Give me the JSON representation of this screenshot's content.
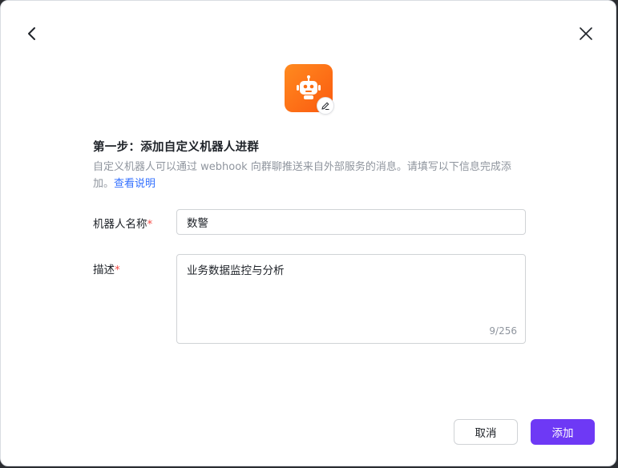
{
  "dialog": {
    "back_icon": "chevron-left-icon",
    "close_icon": "close-icon",
    "avatar_icon": "robot-icon",
    "edit_icon": "pencil-icon",
    "accent_color": "#6e39f5",
    "avatar_color": "#fb6f14"
  },
  "step": {
    "title": "第一步：添加自定义机器人进群",
    "description": "自定义机器人可以通过 webhook 向群聊推送来自外部服务的消息。请填写以下信息完成添加。",
    "help_link": "查看说明"
  },
  "form": {
    "name_label": "机器人名称",
    "name_value": "数警",
    "desc_label": "描述",
    "desc_value": "业务数据监控与分析",
    "desc_counter": "9/256",
    "required_mark": "*"
  },
  "footer": {
    "cancel_label": "取消",
    "add_label": "添加"
  }
}
